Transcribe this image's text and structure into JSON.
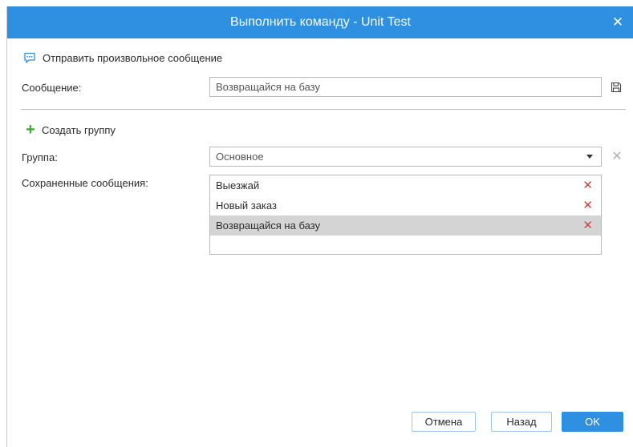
{
  "dialog": {
    "title": "Выполнить команду - Unit Test",
    "close_icon": "close-icon"
  },
  "section": {
    "icon": "message-icon",
    "label": "Отправить произвольное сообщение"
  },
  "message": {
    "label": "Сообщение:",
    "value": "Возвращайся на базу",
    "save_icon": "save-icon"
  },
  "group_action": {
    "icon": "plus-icon",
    "label": "Создать группу"
  },
  "group": {
    "label": "Группа:",
    "selected": "Основное",
    "clear_icon": "close-icon"
  },
  "saved": {
    "label": "Сохраненные сообщения:",
    "items": [
      {
        "text": "Выезжай",
        "selected": false
      },
      {
        "text": "Новый заказ",
        "selected": false
      },
      {
        "text": "Возвращайся на базу",
        "selected": true
      }
    ]
  },
  "buttons": {
    "cancel": "Отмена",
    "back": "Назад",
    "ok": "OK"
  },
  "colors": {
    "accent": "#2f8fe0",
    "delete": "#e03a3a",
    "add": "#3fa535"
  }
}
